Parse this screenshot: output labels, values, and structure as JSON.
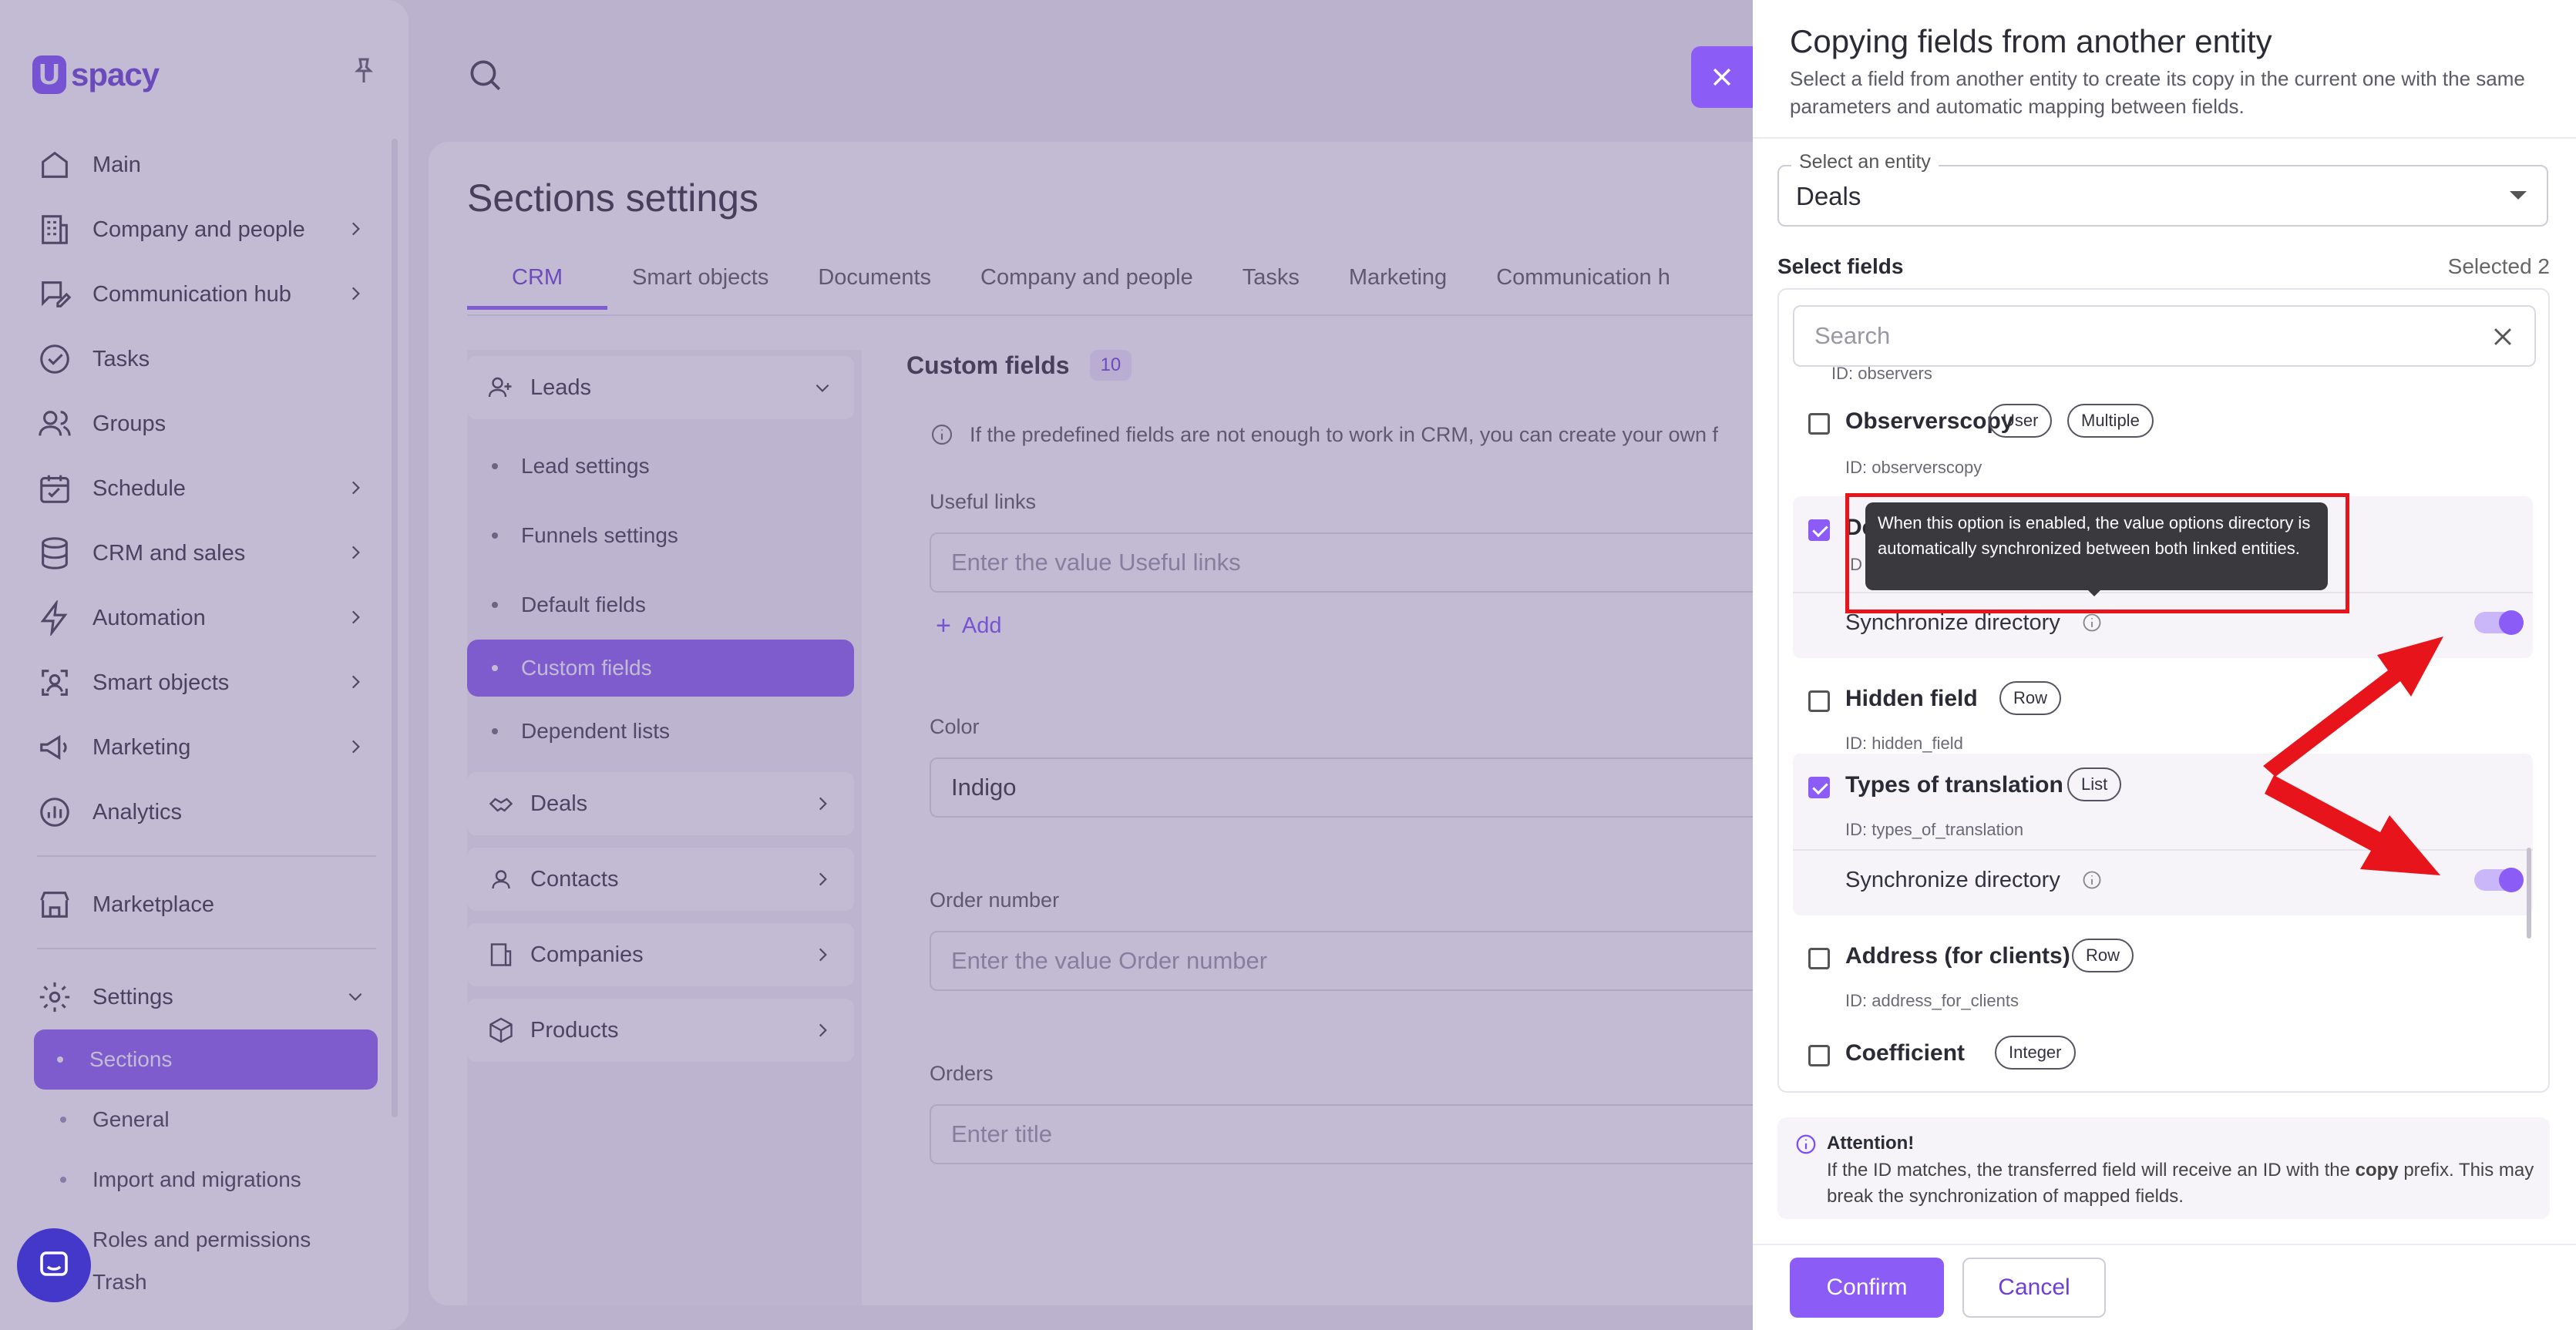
{
  "app": {
    "logo_text": "spacy",
    "logo_mark": "U"
  },
  "sidebar": {
    "items": [
      {
        "label": "Main",
        "icon": "home-icon"
      },
      {
        "label": "Company and people",
        "icon": "building-icon"
      },
      {
        "label": "Communication hub",
        "icon": "chat-edit-icon"
      },
      {
        "label": "Tasks",
        "icon": "check-circle-icon"
      },
      {
        "label": "Groups",
        "icon": "users-icon"
      },
      {
        "label": "Schedule",
        "icon": "calendar-icon"
      },
      {
        "label": "CRM and sales",
        "icon": "database-icon"
      },
      {
        "label": "Automation",
        "icon": "lightning-icon"
      },
      {
        "label": "Smart objects",
        "icon": "scan-icon"
      },
      {
        "label": "Marketing",
        "icon": "megaphone-icon"
      },
      {
        "label": "Analytics",
        "icon": "analytics-icon"
      }
    ],
    "marketplace": "Marketplace",
    "settings": "Settings",
    "settings_sub": [
      "Sections",
      "General",
      "Import and migrations",
      "Roles and permissions",
      "Trash"
    ]
  },
  "page": {
    "title": "Sections settings",
    "tabs": [
      "CRM",
      "Smart objects",
      "Documents",
      "Company and people",
      "Tasks",
      "Marketing",
      "Communication h"
    ],
    "left_panel": {
      "leads": "Leads",
      "leads_sub": [
        "Lead settings",
        "Funnels settings",
        "Default fields",
        "Custom fields",
        "Dependent lists"
      ],
      "groups": [
        "Deals",
        "Contacts",
        "Companies",
        "Products"
      ]
    },
    "custom_fields": {
      "title": "Custom fields",
      "count": "10",
      "info": "If the predefined fields are not enough to work in CRM, you can create your own f",
      "useful_links_label": "Useful links",
      "useful_links_placeholder": "Enter the value Useful links",
      "add_label": "Add",
      "color_label": "Color",
      "color_value": "Indigo",
      "order_label": "Order number",
      "order_placeholder": "Enter the value Order number",
      "orders_label": "Orders",
      "orders_placeholder": "Enter title"
    }
  },
  "drawer": {
    "title": "Copying fields from another entity",
    "description": "Select a field from another entity to create its copy in the current one with the same parameters and automatic mapping between fields.",
    "entity_legend": "Select an entity",
    "entity_value": "Deals",
    "select_fields_label": "Select fields",
    "selected_count": "Selected 2",
    "search_placeholder": "Search",
    "fields": [
      {
        "name": "",
        "id": "ID: observers",
        "checked": false
      },
      {
        "name": "Observerscopy",
        "id": "ID: observerscopy",
        "tags": [
          "User",
          "Multiple"
        ],
        "checked": false
      },
      {
        "name": "De",
        "id": "ID",
        "checked": true,
        "sync_label": "Synchronize directory",
        "sync_on": true
      },
      {
        "name": "Hidden field",
        "id": "ID: hidden_field",
        "tags": [
          "Row"
        ],
        "checked": false
      },
      {
        "name": "Types of translation",
        "id": "ID: types_of_translation",
        "tags": [
          "List"
        ],
        "checked": true,
        "sync_label": "Synchronize directory",
        "sync_on": true
      },
      {
        "name": "Address (for clients)",
        "id": "ID: address_for_clients",
        "tags": [
          "Row"
        ],
        "checked": false
      },
      {
        "name": "Coefficient",
        "id": "ID: coefficient",
        "tags": [
          "Integer"
        ],
        "checked": false
      }
    ],
    "tooltip": "When this option is enabled, the value options directory is automatically synchronized between both linked entities.",
    "attention_title": "Attention!",
    "attention_text_1": "If the ID matches, the transferred field will receive an ID with the ",
    "attention_bold": "copy",
    "attention_text_2": " prefix. This may break the synchronization of mapped fields.",
    "confirm": "Confirm",
    "cancel": "Cancel"
  },
  "colors": {
    "accent": "#8b5cf6",
    "annotation_red": "#e8141c",
    "tooltip_bg": "#3a3a3e"
  }
}
